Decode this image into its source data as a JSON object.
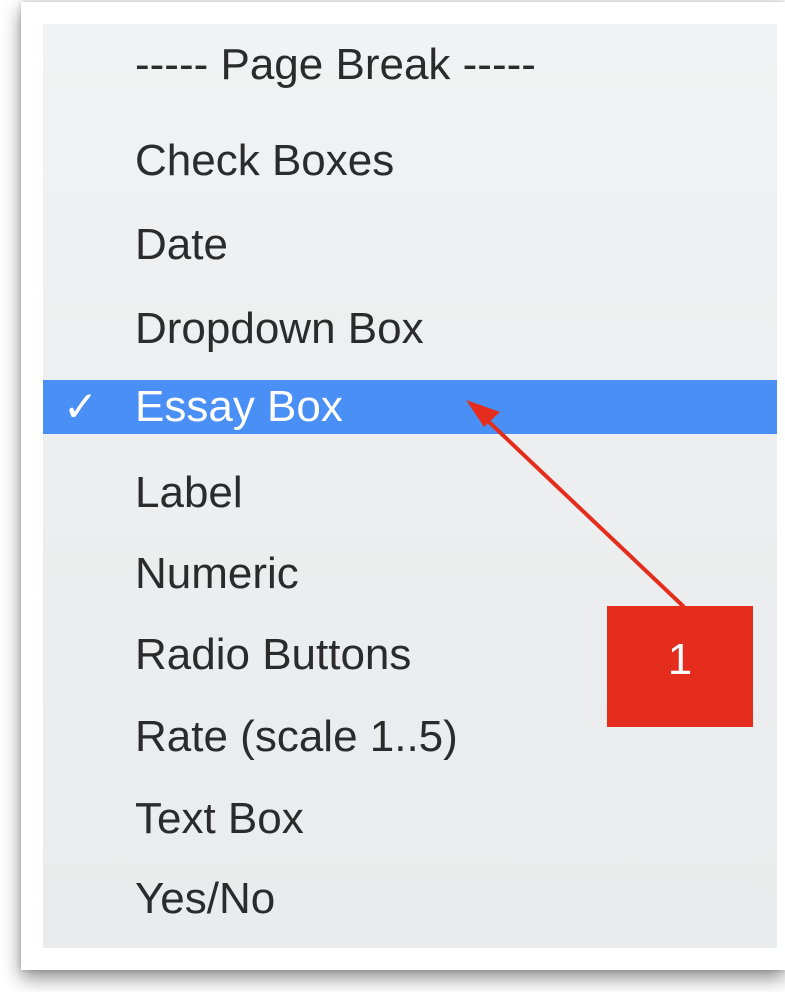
{
  "menu": {
    "items": [
      {
        "label": "----- Page Break -----",
        "check": ""
      },
      {
        "label": "Check Boxes",
        "check": ""
      },
      {
        "label": "Date",
        "check": ""
      },
      {
        "label": "Dropdown Box",
        "check": ""
      },
      {
        "label": "Essay Box",
        "check": "✓"
      },
      {
        "label": "Label",
        "check": ""
      },
      {
        "label": "Numeric",
        "check": ""
      },
      {
        "label": "Radio Buttons",
        "check": ""
      },
      {
        "label": "Rate (scale 1..5)",
        "check": ""
      },
      {
        "label": "Text Box",
        "check": ""
      },
      {
        "label": "Yes/No",
        "check": ""
      }
    ],
    "selected_index": 4,
    "selection_color": "#4a8ff5"
  },
  "annotation": {
    "badge_label": "1",
    "color": "#e42d1c"
  }
}
